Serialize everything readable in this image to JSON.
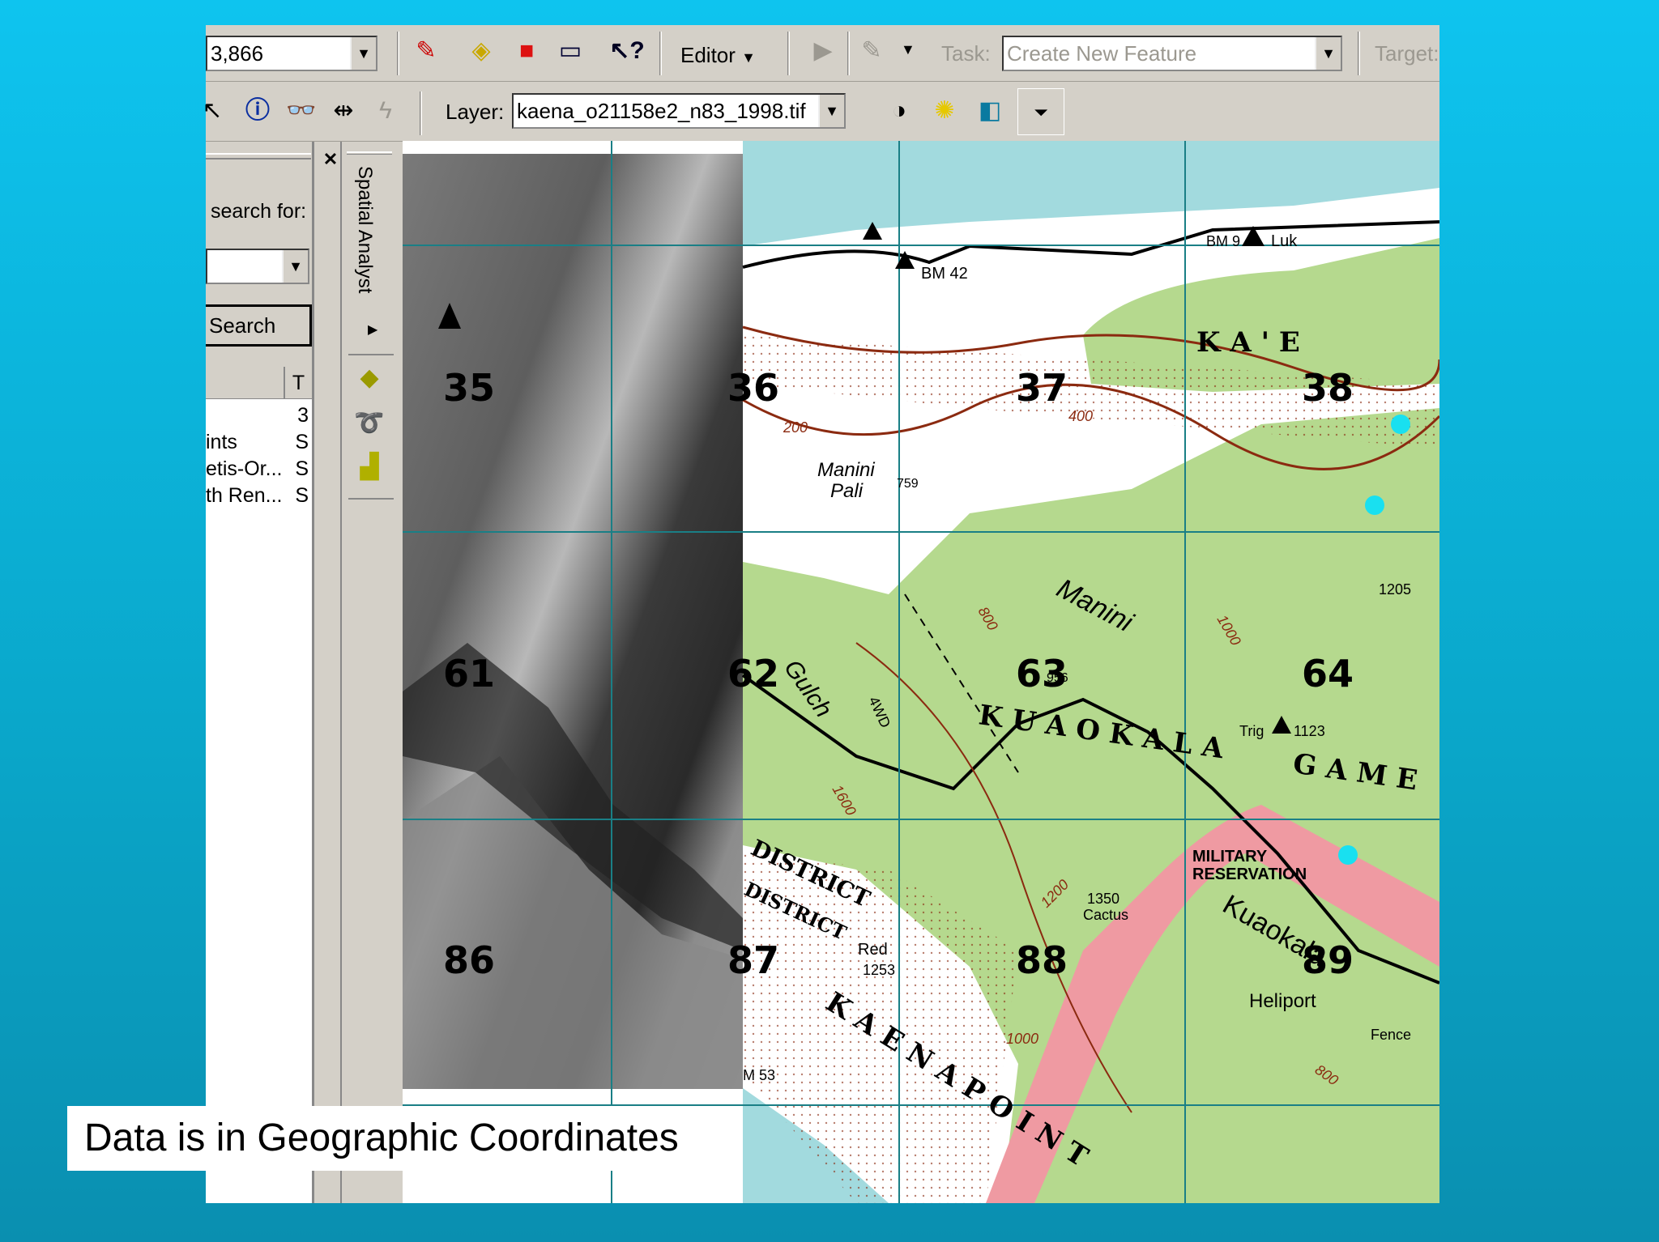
{
  "toolbar1": {
    "scale_value": "3,866",
    "editor_label": "Editor",
    "task_label": "Task:",
    "task_value": "Create New Feature",
    "target_label": "Target:"
  },
  "toolbar2": {
    "layer_label": "Layer:",
    "layer_value": "kaena_o21158e2_n83_1998.tif"
  },
  "search_panel": {
    "search_for_label": "search for:",
    "search_button": "Search",
    "column_header": "T",
    "rows": [
      {
        "name": "",
        "type": "3"
      },
      {
        "name": "ints",
        "type": "S"
      },
      {
        "name": "etis-Or...",
        "type": "S"
      },
      {
        "name": "th Ren...",
        "type": "S"
      }
    ]
  },
  "spatial_analyst": {
    "title": "Spatial Analyst"
  },
  "map": {
    "tile_numbers": [
      "35",
      "36",
      "37",
      "38",
      "61",
      "62",
      "63",
      "64",
      "86",
      "87",
      "88",
      "89"
    ],
    "labels": {
      "kae": "K A ' E",
      "kuaokala": "K U A O K A L A",
      "game": "G A M E",
      "kaena_point": "K A E N A  P O I N T",
      "district1": "DISTRICT",
      "district2": "DISTRICT",
      "military": "MILITARY",
      "reservation": "RESERVATION",
      "manini_pali1": "Manini",
      "manini_pali2": "Pali",
      "manini": "Manini",
      "gulch": "Gulch",
      "kuaokala_road": "Kuaokala",
      "heliport": "Heliport",
      "fence": "Fence",
      "bm42": "BM 42",
      "luk": "Luk",
      "bm": "BM 9",
      "trig": "Trig",
      "e1123": "1123",
      "e1205": "1205",
      "e1253": "1253",
      "red": "Red",
      "e1350": "1350",
      "cactus": "Cactus",
      "c200": "200",
      "c400": "400",
      "c800": "800",
      "c1000": "1000",
      "c1200": "1200",
      "c1600": "1600",
      "c800b": "800",
      "c1000b": "1000",
      "e759": "759",
      "e956": "956",
      "fwd": "4WD",
      "m53": "M 53"
    }
  },
  "caption": "Data is in Geographic Coordinates",
  "colors": {
    "background": "#0ec4ef",
    "window": "#d4d0c8",
    "water": "#a2dade",
    "vegetation": "#b5d98e",
    "contour": "#8b2a10",
    "grid": "#1a7f86",
    "road_pink": "#ef9aa2",
    "point_cyan": "#19e0f0"
  }
}
